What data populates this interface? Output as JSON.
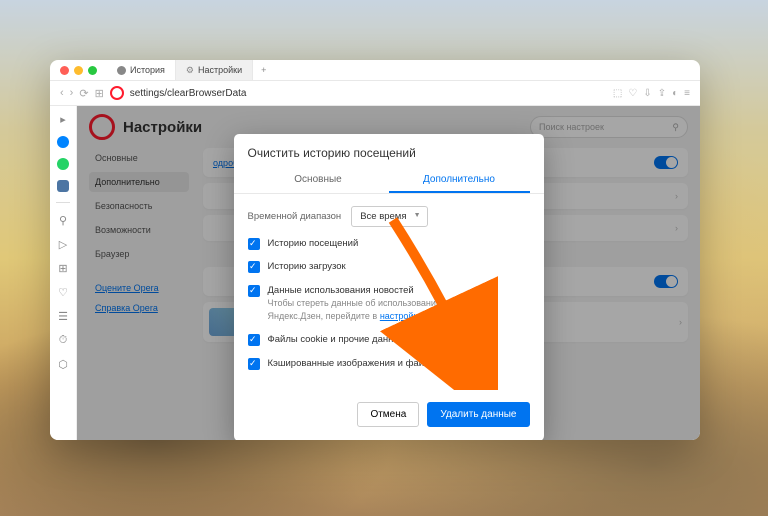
{
  "tabs": [
    {
      "label": "История"
    },
    {
      "label": "Настройки"
    }
  ],
  "url": "settings/clearBrowserData",
  "page": {
    "title": "Настройки",
    "search_placeholder": "Поиск настроек"
  },
  "sidenav": {
    "items": [
      {
        "label": "Основные"
      },
      {
        "label": "Дополнительно"
      },
      {
        "label": "Безопасность"
      },
      {
        "label": "Возможности"
      },
      {
        "label": "Браузер"
      }
    ],
    "links": [
      {
        "label": "Оцените Opera"
      },
      {
        "label": "Справка Opera"
      }
    ]
  },
  "rows": {
    "more_link": "одробнее.."
  },
  "dialog": {
    "title": "Очистить историю посещений",
    "tabs": [
      "Основные",
      "Дополнительно"
    ],
    "range_label": "Временной диапазон",
    "range_value": "Все время",
    "items": [
      {
        "label": "Историю посещений"
      },
      {
        "label": "Историю загрузок"
      },
      {
        "label": "Данные использования новостей",
        "sub": "Чтобы стереть данные об использовании новостей Яндекс.Дзен, перейдите в",
        "link": "настройки Яндекс.Дзен"
      },
      {
        "label": "Файлы cookie и прочие данные сайтов"
      },
      {
        "label": "Кэшированные изображения и файлы"
      }
    ],
    "cancel": "Отмена",
    "confirm": "Удалить данные"
  }
}
